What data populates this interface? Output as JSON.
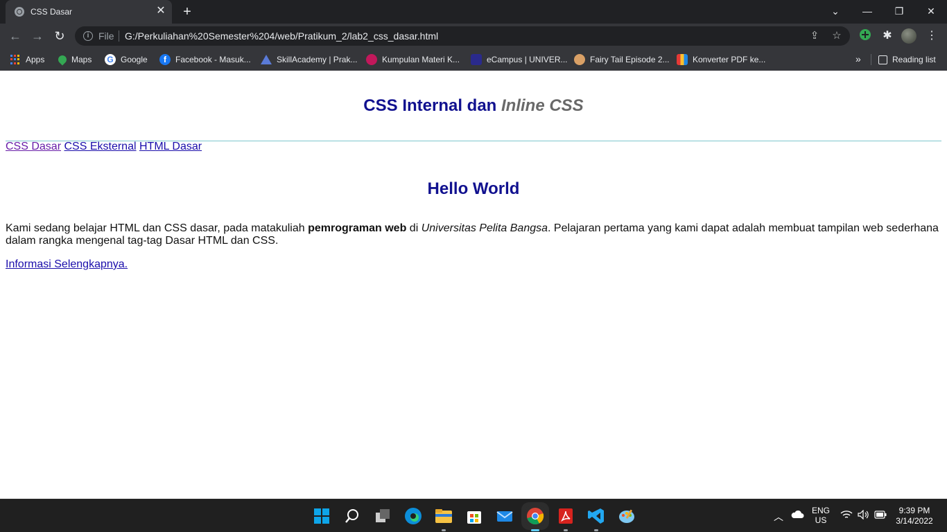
{
  "browser": {
    "tab_title": "CSS Dasar",
    "tab_close": "✕",
    "new_tab": "+",
    "address_scheme": "File",
    "address_url": "G:/Perkuliahan%20Semester%204/web/Pratikum_2/lab2_css_dasar.html",
    "bookmarks": [
      {
        "label": "Apps",
        "icon": "apps-grid-icon"
      },
      {
        "label": "Maps",
        "icon": "maps-pin-icon",
        "color": "#34a853"
      },
      {
        "label": "Google",
        "icon": "google-icon",
        "color": "#4285f4"
      },
      {
        "label": "Facebook - Masuk...",
        "icon": "facebook-icon",
        "color": "#1877f2"
      },
      {
        "label": "SkillAcademy | Prak...",
        "icon": "skillacademy-icon",
        "color": "#5a7bd8"
      },
      {
        "label": "Kumpulan Materi K...",
        "icon": "materi-icon",
        "color": "#c2185b"
      },
      {
        "label": "eCampus | UNIVER...",
        "icon": "ecampus-icon",
        "color": "#2a2a8c"
      },
      {
        "label": "Fairy Tail Episode 2...",
        "icon": "fairytail-icon",
        "color": "#d9a066"
      },
      {
        "label": "Konverter PDF ke...",
        "icon": "pdf-converter-icon",
        "color": "#e53935"
      }
    ],
    "bookmarks_overflow": "»",
    "reading_list": "Reading list"
  },
  "page": {
    "heading_main": "CSS Internal dan ",
    "heading_em": "Inline CSS",
    "nav_links": [
      "CSS Dasar",
      "CSS Eksternal",
      "HTML Dasar"
    ],
    "subheading": "Hello World",
    "para_1": "Kami sedang belajar HTML dan CSS dasar, pada matakuliah ",
    "para_bold": "pemrograman web",
    "para_2": " di ",
    "para_italic": "Universitas Pelita Bangsa",
    "para_3": ". Pelajaran pertama yang kami dapat adalah membuat tampilan web sederhana dalam rangka mengenal tag-tag Dasar HTML dan CSS.",
    "more_link": "Informasi Selengkapnya."
  },
  "taskbar": {
    "lang_1": "ENG",
    "lang_2": "US",
    "time": "9:39 PM",
    "date": "3/14/2022"
  }
}
